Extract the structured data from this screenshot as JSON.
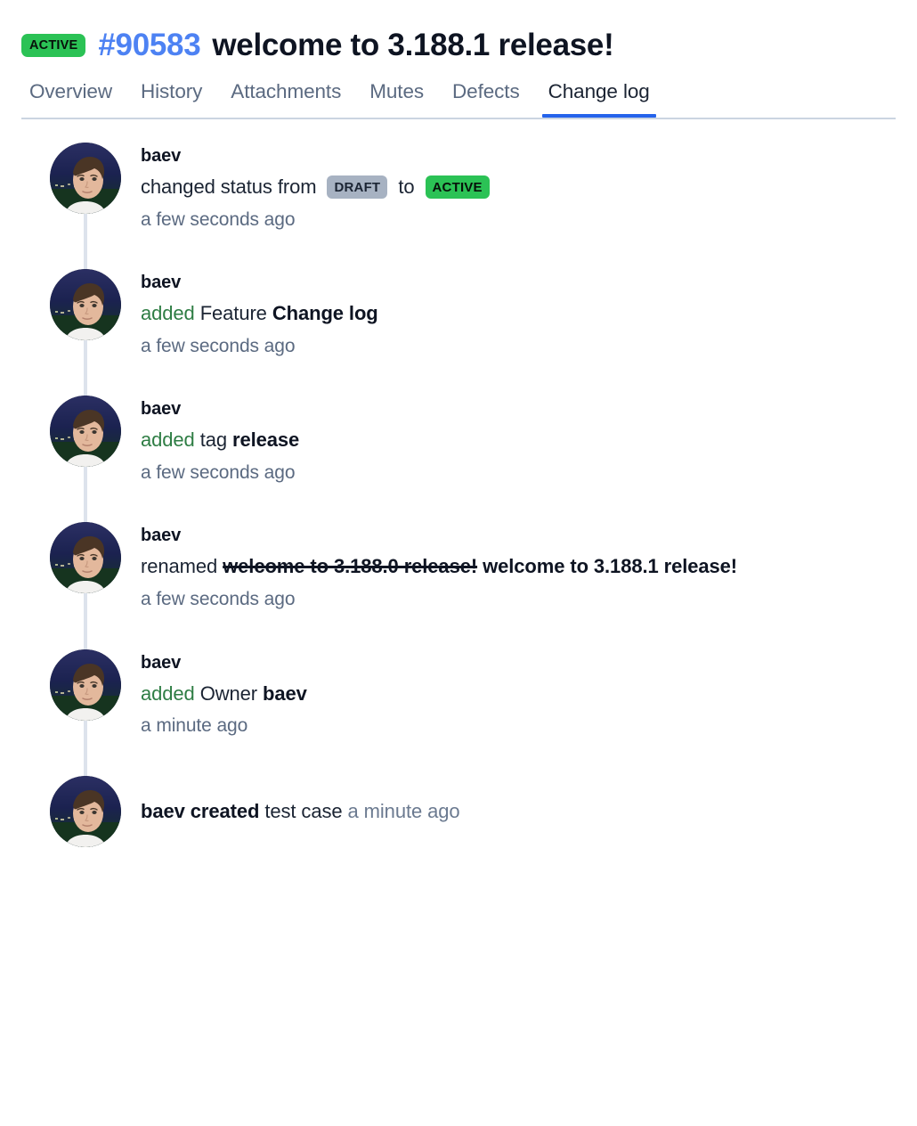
{
  "header": {
    "status_badge": "ACTIVE",
    "issue_id": "#90583",
    "title": "welcome to 3.188.1 release!",
    "id_color": "#4d82f3",
    "badge_color": "#2bc255"
  },
  "tabs": {
    "items": [
      {
        "label": "Overview",
        "active": false
      },
      {
        "label": "History",
        "active": false
      },
      {
        "label": "Attachments",
        "active": false
      },
      {
        "label": "Mutes",
        "active": false
      },
      {
        "label": "Defects",
        "active": false
      },
      {
        "label": "Change log",
        "active": true
      }
    ],
    "active_underline_color": "#2563eb"
  },
  "changelog": {
    "entries": [
      {
        "author": "baev",
        "avatar": "user-photo-avatar",
        "action_prefix": "changed status from",
        "from_badge": "DRAFT",
        "connector": "to",
        "to_badge": "ACTIVE",
        "timestamp": "a few seconds ago"
      },
      {
        "author": "baev",
        "avatar": "user-photo-avatar",
        "verb": "added",
        "field": "Feature",
        "value": "Change log",
        "timestamp": "a few seconds ago"
      },
      {
        "author": "baev",
        "avatar": "user-photo-avatar",
        "verb": "added",
        "field": "tag",
        "value": "release",
        "timestamp": "a few seconds ago"
      },
      {
        "author": "baev",
        "avatar": "user-photo-avatar",
        "verb": "renamed",
        "old_value": "welcome to 3.188.0 release!",
        "new_value": "welcome to 3.188.1 release!",
        "timestamp": "a few seconds ago"
      },
      {
        "author": "baev",
        "avatar": "user-photo-avatar",
        "verb": "added",
        "field": "Owner",
        "value": "baev",
        "timestamp": "a minute ago"
      },
      {
        "author": "baev",
        "avatar": "user-photo-avatar",
        "created_label": "baev created",
        "created_object": "test case",
        "timestamp": "a minute ago"
      }
    ]
  }
}
